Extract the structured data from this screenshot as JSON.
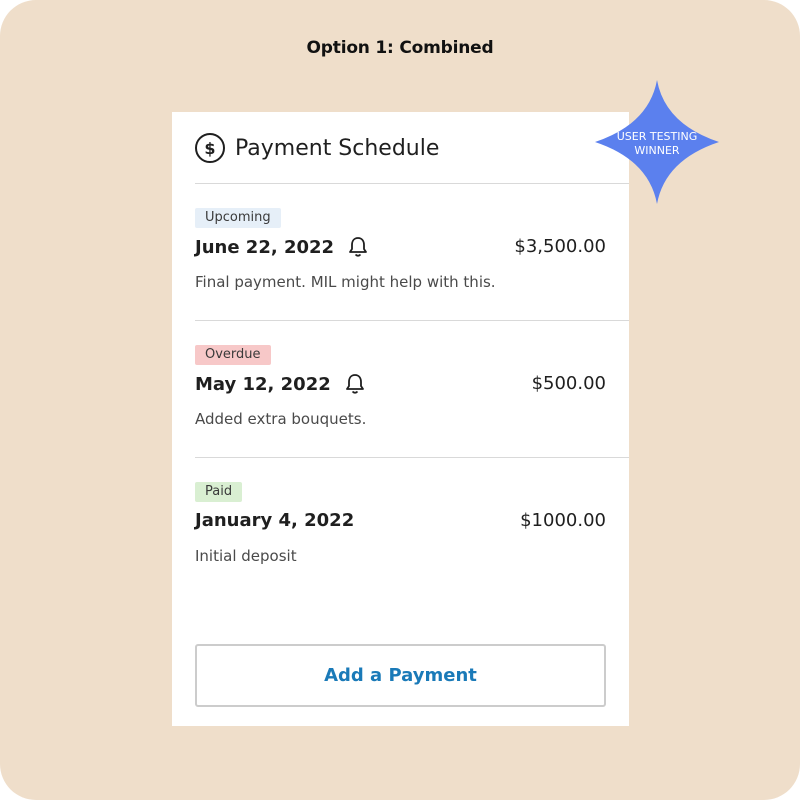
{
  "board": {
    "title": "Option 1: Combined"
  },
  "card": {
    "title": "Payment Schedule",
    "icon": "dollar-circle-icon",
    "payments": [
      {
        "status": "Upcoming",
        "date": "June 22, 2022",
        "amount": "$3,500.00",
        "note": "Final payment. MIL might help with this.",
        "reminder": true
      },
      {
        "status": "Overdue",
        "date": "May 12, 2022",
        "amount": "$500.00",
        "note": "Added extra bouquets.",
        "reminder": true
      },
      {
        "status": "Paid",
        "date": "January 4, 2022",
        "amount": "$1000.00",
        "note": "Initial deposit",
        "reminder": false
      }
    ],
    "add_button_label": "Add a Payment"
  },
  "winner_badge": {
    "line1": "USER TESTING",
    "line2": "WINNER"
  },
  "colors": {
    "background": "#efdeca",
    "accent_link": "#1a7ab8",
    "winner": "#5b80ee",
    "upcoming": "#e6eff8",
    "overdue": "#f7c8c8",
    "paid": "#d9efd2"
  }
}
